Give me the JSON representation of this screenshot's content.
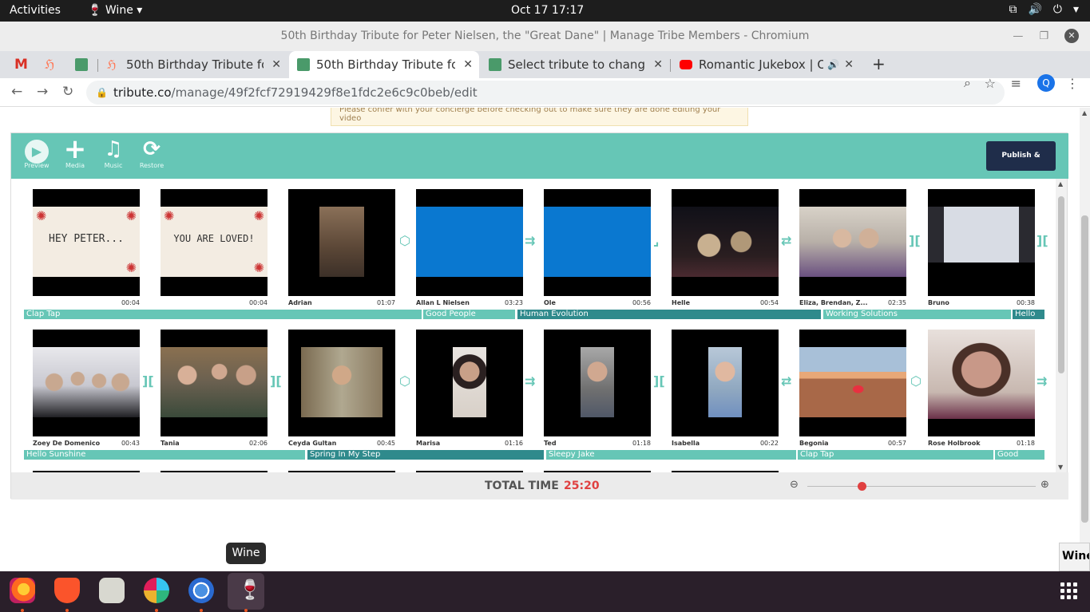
{
  "system": {
    "activities": "Activities",
    "app_name": "Wine",
    "clock": "Oct 17  17:17"
  },
  "window": {
    "title": "50th Birthday Tribute for Peter Nielsen, the \"Great Dane\" | Manage Tribe Members - Chromium"
  },
  "tabs": [
    {
      "label": "50th Birthday Tribute for"
    },
    {
      "label": "50th Birthday Tribute for"
    },
    {
      "label": "Select tribute to change |"
    },
    {
      "label": "Romantic Jukebox | Ol"
    }
  ],
  "address_bar": {
    "host": "tribute.co",
    "path": "/manage/49f2fcf72919429f8e1fdc2e6c9c0beb/edit",
    "avatar_letter": "Q"
  },
  "notice_text": "Please confer with your concierge before checking out to make sure they are done editing your video",
  "toolbar": {
    "preview": "Preview",
    "media": "Media",
    "music": "Music",
    "restore": "Restore",
    "publish": "Publish & Checkout"
  },
  "clips_row1": [
    {
      "name": "",
      "duration": "00:04",
      "text": "HEY PETER..."
    },
    {
      "name": "",
      "duration": "00:04",
      "text": "YOU ARE LOVED!"
    },
    {
      "name": "Adrian",
      "duration": "01:07"
    },
    {
      "name": "Allan L Nielsen",
      "duration": "03:23"
    },
    {
      "name": "Ole",
      "duration": "00:56"
    },
    {
      "name": "Helle",
      "duration": "00:54"
    },
    {
      "name": "Eliza, Brendan, Z...",
      "duration": "02:35"
    },
    {
      "name": "Bruno",
      "duration": "00:38"
    }
  ],
  "clips_row2": [
    {
      "name": "Zoey De Domenico",
      "duration": "00:43"
    },
    {
      "name": "Tania",
      "duration": "02:06"
    },
    {
      "name": "Ceyda Gultan",
      "duration": "00:45"
    },
    {
      "name": "Marisa",
      "duration": "01:16"
    },
    {
      "name": "Ted",
      "duration": "01:18"
    },
    {
      "name": "Isabella",
      "duration": "00:22"
    },
    {
      "name": "Begonia",
      "duration": "00:57"
    },
    {
      "name": "Rose Holbrook",
      "duration": "01:18"
    }
  ],
  "music_row1": [
    "Clap Tap",
    "Good People",
    "Human Evolution",
    "Working Solutions",
    "Hello"
  ],
  "music_row2": [
    "Hello Sunshine",
    "Spring In My Step",
    "Sleepy Jake",
    "Clap Tap",
    "Good"
  ],
  "footer": {
    "total_label": "TOTAL TIME",
    "total_value": "25:20"
  },
  "tooltip": "Wine",
  "wine_popup": "Wine",
  "colors": {
    "teal": "#66c6b6",
    "dark_teal": "#2f8a8c",
    "publish_bg": "#1f2d4a",
    "total_time": "#e04040"
  }
}
